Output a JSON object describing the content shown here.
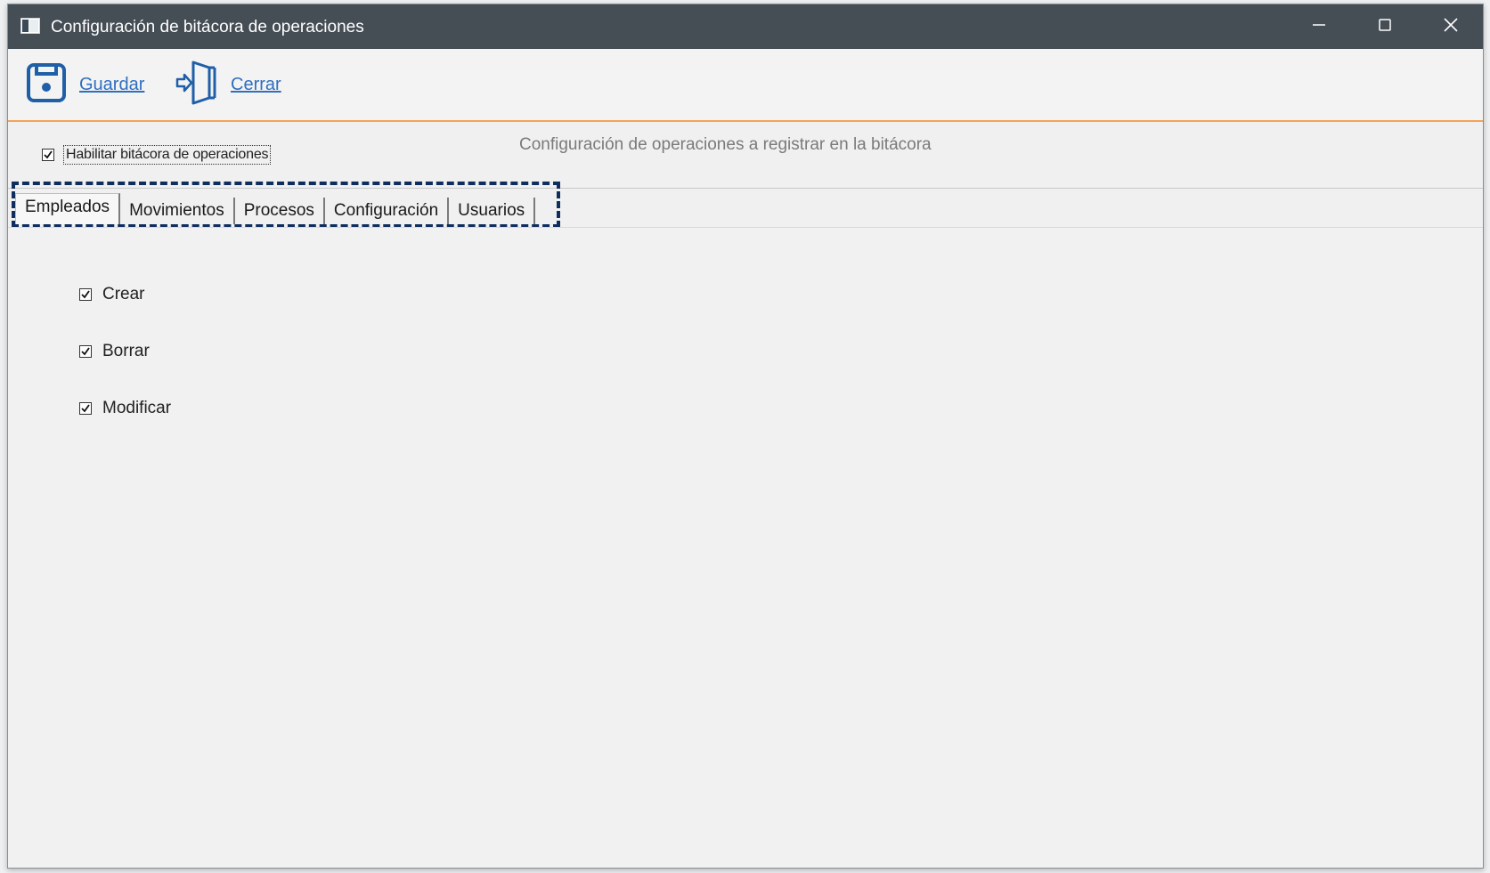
{
  "window": {
    "title": "Configuración de bitácora de operaciones",
    "controls": {
      "minimize": "minimize-icon",
      "maximize": "maximize-icon",
      "close": "close-icon"
    }
  },
  "toolbar": {
    "save_label": "Guardar",
    "close_label": "Cerrar",
    "accent_color": "#f5a25a",
    "link_color": "#2f6fbf"
  },
  "enable_logging": {
    "label": "Habilitar bitácora de operaciones",
    "checked": true
  },
  "section_title": "Configuración de operaciones a registrar en la bitácora",
  "tabs": [
    {
      "label": "Empleados",
      "active": true
    },
    {
      "label": "Movimientos",
      "active": false
    },
    {
      "label": "Procesos",
      "active": false
    },
    {
      "label": "Configuración",
      "active": false
    },
    {
      "label": "Usuarios",
      "active": false
    }
  ],
  "operations": [
    {
      "label": "Crear",
      "checked": true
    },
    {
      "label": "Borrar",
      "checked": true
    },
    {
      "label": "Modificar",
      "checked": true
    }
  ]
}
